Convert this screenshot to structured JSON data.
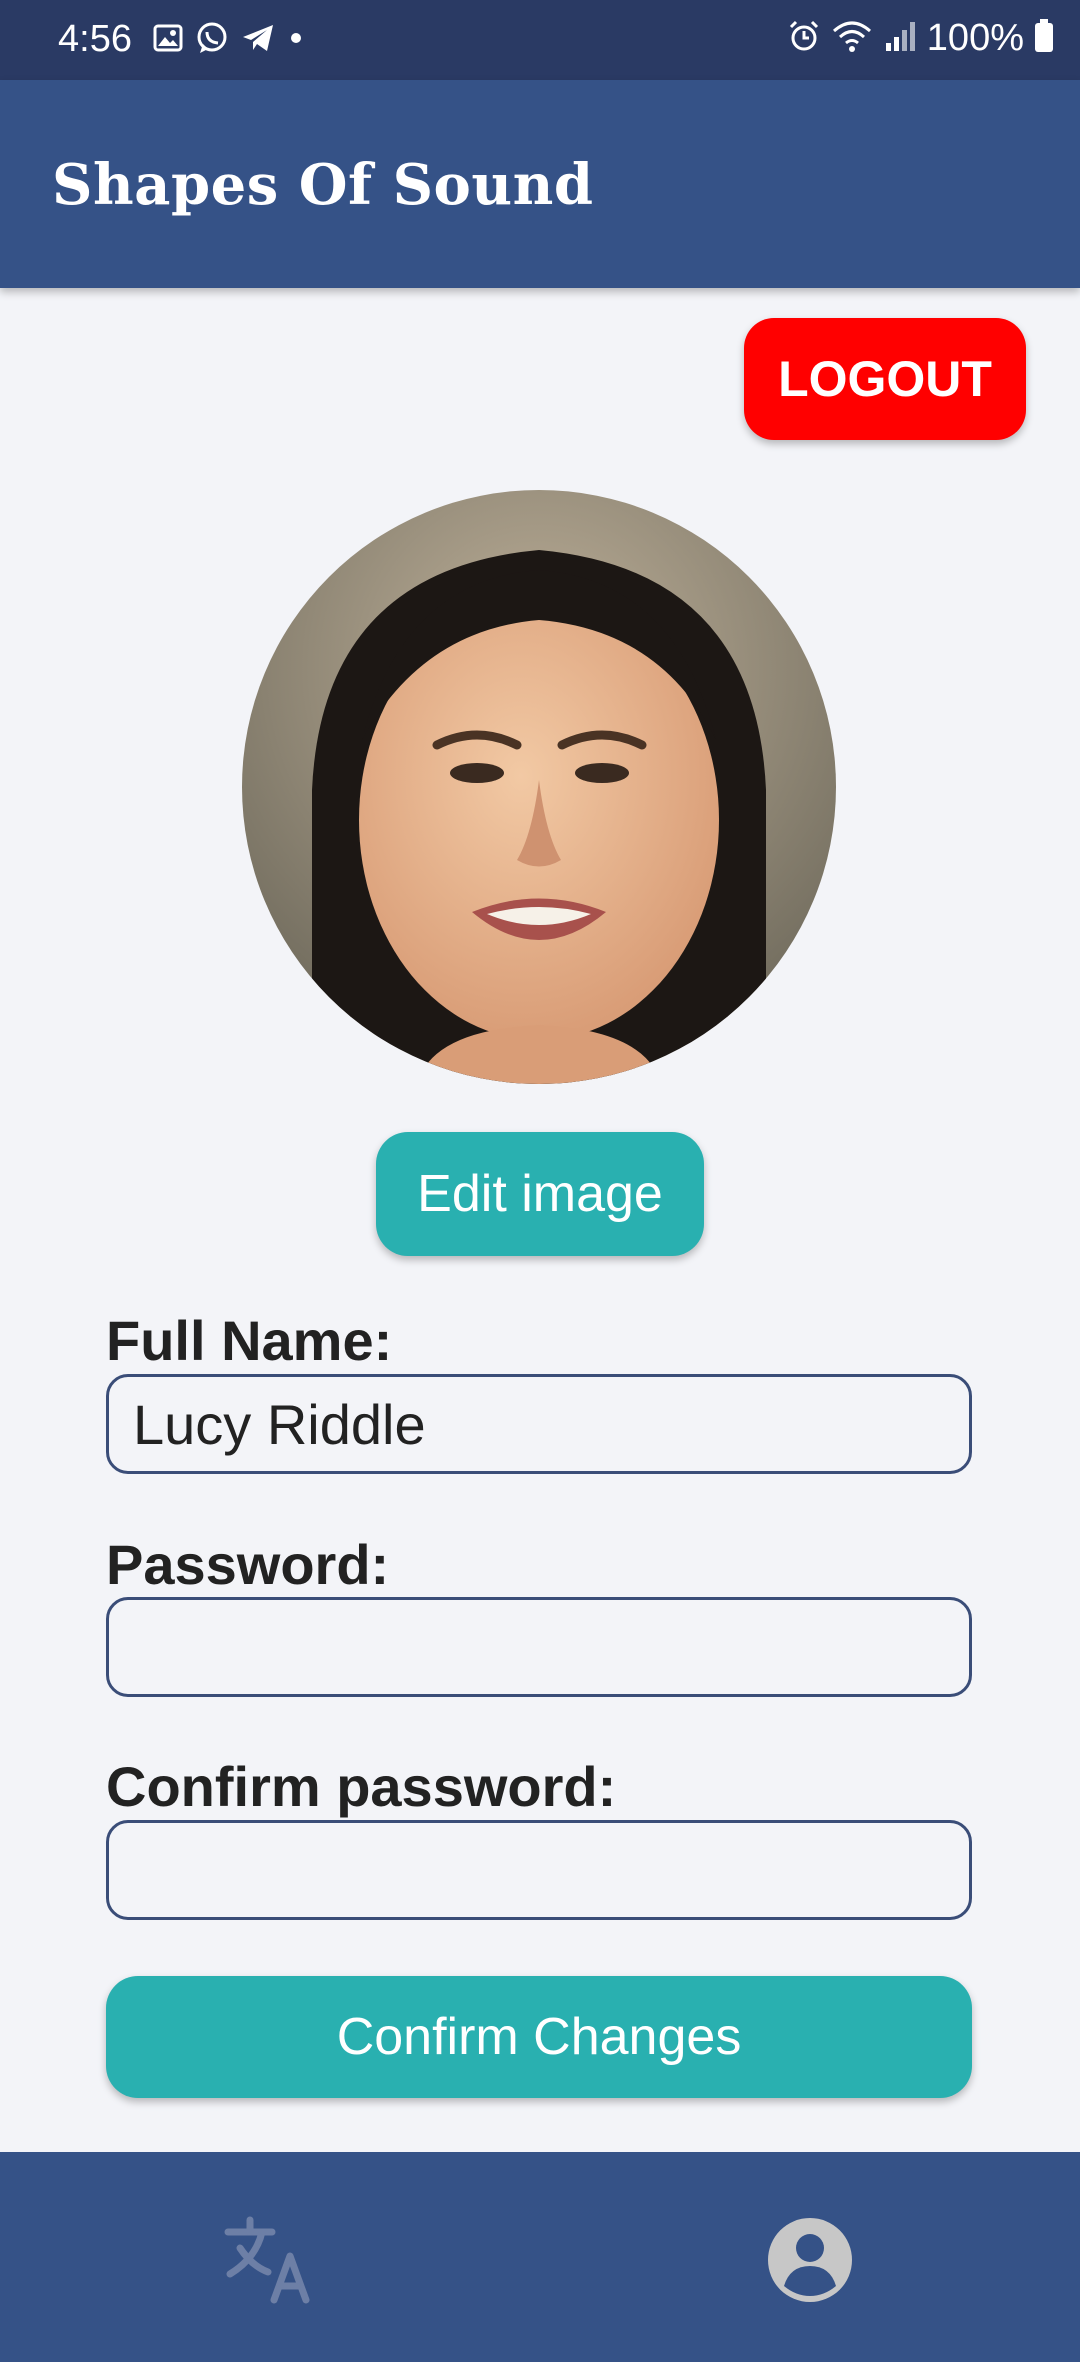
{
  "status_bar": {
    "time": "4:56",
    "left_icons": [
      "gallery-icon",
      "whatsapp-icon",
      "telegram-icon",
      "dot-icon"
    ],
    "right_icons": [
      "alarm-icon",
      "wifi-icon",
      "signal-icon",
      "battery-icon"
    ],
    "battery": "100%"
  },
  "app": {
    "title": "Shapes Of Sound"
  },
  "logout": {
    "label": "LOGOUT",
    "color": "#ff0000"
  },
  "profile": {
    "avatar": "user-photo",
    "edit_image_label": "Edit image"
  },
  "form": {
    "full_name": {
      "label": "Full Name:",
      "value": "Lucy Riddle"
    },
    "password": {
      "label": "Password:",
      "value": ""
    },
    "confirm_password": {
      "label": "Confirm password:",
      "value": ""
    },
    "submit_label": "Confirm Changes"
  },
  "bottom_nav": {
    "items": [
      {
        "icon": "translate-icon",
        "active": false
      },
      {
        "icon": "account-icon",
        "active": true
      }
    ]
  },
  "colors": {
    "status_bar": "#2a3a64",
    "primary": "#355287",
    "accent": "#29b0b0",
    "background": "#f3f4f8",
    "danger": "#ff0000"
  }
}
